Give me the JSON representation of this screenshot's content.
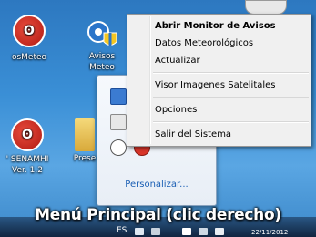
{
  "desktop": {
    "icons": [
      {
        "label": "osMeteo"
      },
      {
        "label": "Avisos\nMeteo"
      },
      {
        "label": "' SENAMHI\nVer. 1.2"
      },
      {
        "label": "Prese"
      }
    ]
  },
  "context_menu": {
    "items": [
      {
        "label": "Abrir Monitor de Avisos",
        "bold": true
      },
      {
        "label": "Datos Meteorológicos"
      },
      {
        "label": "Actualizar"
      },
      {
        "label": "Visor Imagenes Satelitales"
      },
      {
        "label": "Opciones"
      },
      {
        "label": "Salir del Sistema"
      }
    ]
  },
  "tray_popup": {
    "customize_label": "Personalizar..."
  },
  "caption": "Menú Principal (clic derecho)",
  "taskbar": {
    "language": "ES",
    "clock": "22/11/2012"
  }
}
